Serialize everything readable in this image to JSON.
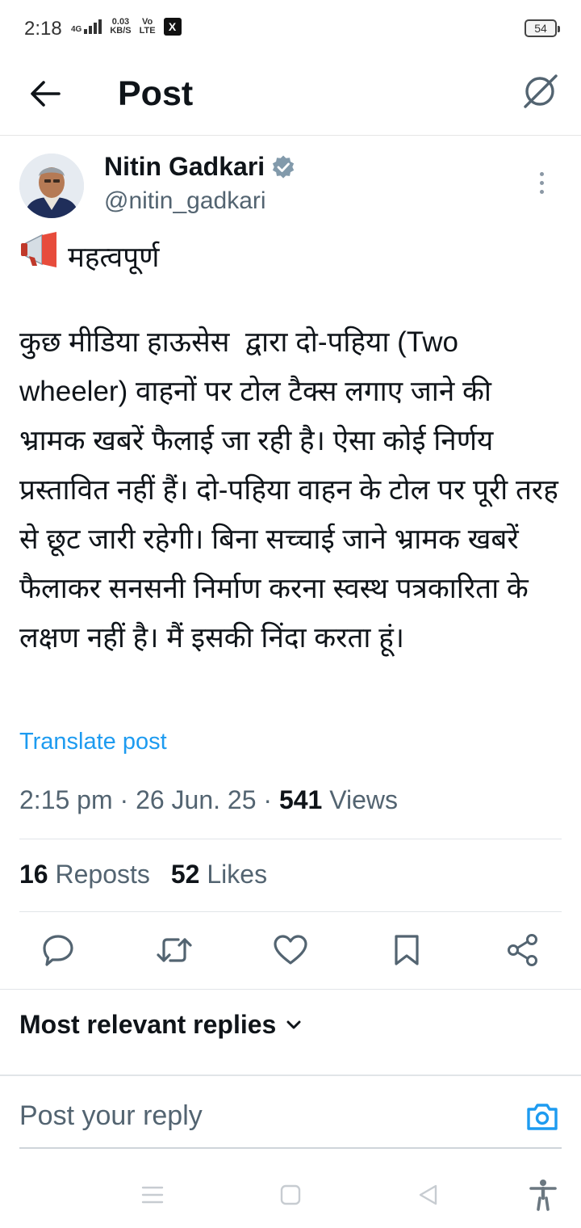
{
  "status_bar": {
    "time": "2:18",
    "network": "4G",
    "speed_value": "0.03",
    "speed_unit": "KB/S",
    "carrier_top": "Vo",
    "carrier_bottom": "LTE",
    "app_badge": "X",
    "battery": "54"
  },
  "header": {
    "title": "Post",
    "back_icon": "arrow-left-icon",
    "grok_icon": "grok-icon"
  },
  "author": {
    "name": "Nitin Gadkari",
    "handle": "@nitin_gadkari",
    "verified": true,
    "verified_color": "#829aab"
  },
  "post": {
    "heading_emoji": "📢",
    "heading": "महत्वपूर्ण",
    "body": "कुछ मीडिया हाऊसेस  द्वारा दो-पहिया (Two wheeler) वाहनों पर टोल टैक्स लगाए जाने की भ्रामक खबरें फैलाई जा रही है। ऐसा कोई निर्णय प्रस्तावित नहीं हैं। दो-पहिया वाहन के टोल पर पूरी तरह से छूट जारी रहेगी। बिना सच्चाई जाने भ्रामक खबरें फैलाकर सनसनी निर्माण करना स्वस्थ पत्रकारिता के लक्षण नहीं है। मैं इसकी निंदा करता हूं।",
    "translate_label": "Translate post",
    "time": "2:15 pm",
    "date": "26 Jun. 25",
    "views_count": "541",
    "views_label": "Views"
  },
  "stats": {
    "reposts_count": "16",
    "reposts_label": "Reposts",
    "likes_count": "52",
    "likes_label": "Likes"
  },
  "actions": [
    "reply-icon",
    "repost-icon",
    "like-icon",
    "bookmark-icon",
    "share-icon"
  ],
  "replies": {
    "sort_label": "Most relevant replies"
  },
  "reply_bar": {
    "placeholder": "Post your reply"
  },
  "colors": {
    "link": "#1d9bf0",
    "text": "#0f1419",
    "secondary": "#536471"
  }
}
